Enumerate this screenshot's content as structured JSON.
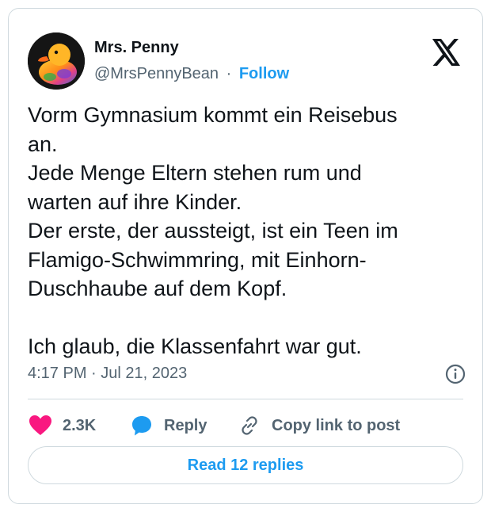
{
  "user": {
    "display_name": "Mrs. Penny",
    "handle": "@MrsPennyBean",
    "separator": "·",
    "follow_label": "Follow",
    "avatar_icon": "rubber-duck-avatar"
  },
  "brand": {
    "logo_icon": "x-logo-icon"
  },
  "tweet": {
    "text": "Vorm Gymnasium kommt ein Reisebus\nan.\nJede Menge Eltern stehen rum und\nwarten auf ihre Kinder.\nDer erste, der aussteigt, ist ein Teen im\nFlamigo-Schwimmring, mit Einhorn-\nDuschhaube auf dem Kopf.\n\nIch glaub, die Klassenfahrt war gut.",
    "timestamp": "4:17 PM · Jul 21, 2023"
  },
  "actions": {
    "likes": "2.3K",
    "reply_label": "Reply",
    "copy_link_label": "Copy link to post"
  },
  "read_replies_label": "Read 12 replies",
  "colors": {
    "accent": "#1d9bf0",
    "like": "#f91880",
    "text_primary": "#0f1419",
    "text_secondary": "#536471",
    "border": "#cfd9de"
  }
}
